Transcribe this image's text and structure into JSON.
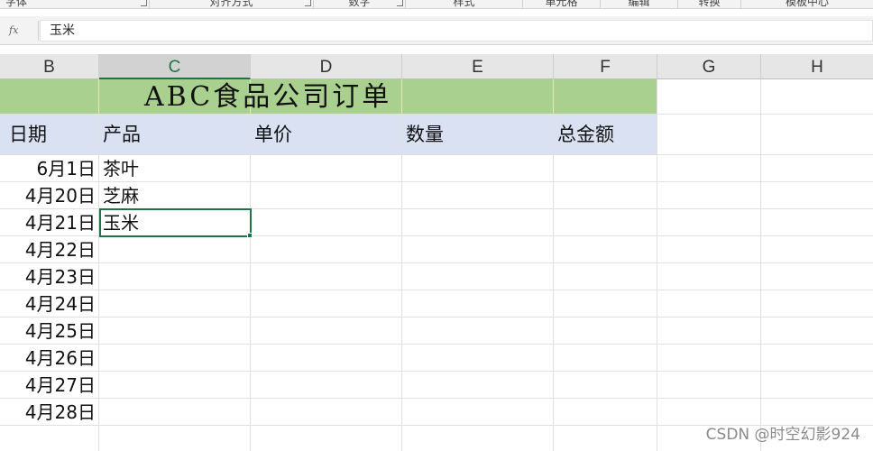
{
  "ribbon": {
    "groups": [
      {
        "label": "字体"
      },
      {
        "label": "对齐方式"
      },
      {
        "label": "数字"
      },
      {
        "label": "样式"
      },
      {
        "label": "单元格"
      },
      {
        "label": "编辑"
      },
      {
        "label": "转换"
      },
      {
        "label": "模板中心"
      }
    ]
  },
  "formula_bar": {
    "fx_label": "fx",
    "value": "玉米"
  },
  "columns": [
    "B",
    "C",
    "D",
    "E",
    "F",
    "G",
    "H"
  ],
  "selected_column": "C",
  "sheet": {
    "title": "ABC食品公司订单",
    "headers": {
      "date": "日期",
      "product": "产品",
      "unit_price": "单价",
      "quantity": "数量",
      "total": "总金额"
    },
    "rows": [
      {
        "date": "6月1日",
        "product": "茶叶"
      },
      {
        "date": "4月20日",
        "product": "芝麻"
      },
      {
        "date": "4月21日",
        "product": "玉米"
      },
      {
        "date": "4月22日",
        "product": ""
      },
      {
        "date": "4月23日",
        "product": ""
      },
      {
        "date": "4月24日",
        "product": ""
      },
      {
        "date": "4月25日",
        "product": ""
      },
      {
        "date": "4月26日",
        "product": ""
      },
      {
        "date": "4月27日",
        "product": ""
      },
      {
        "date": "4月28日",
        "product": ""
      }
    ]
  },
  "watermark": "CSDN @时空幻影924",
  "colors": {
    "title_fill": "#a9d08e",
    "header_fill": "#d9e1f2",
    "selection": "#217346"
  }
}
